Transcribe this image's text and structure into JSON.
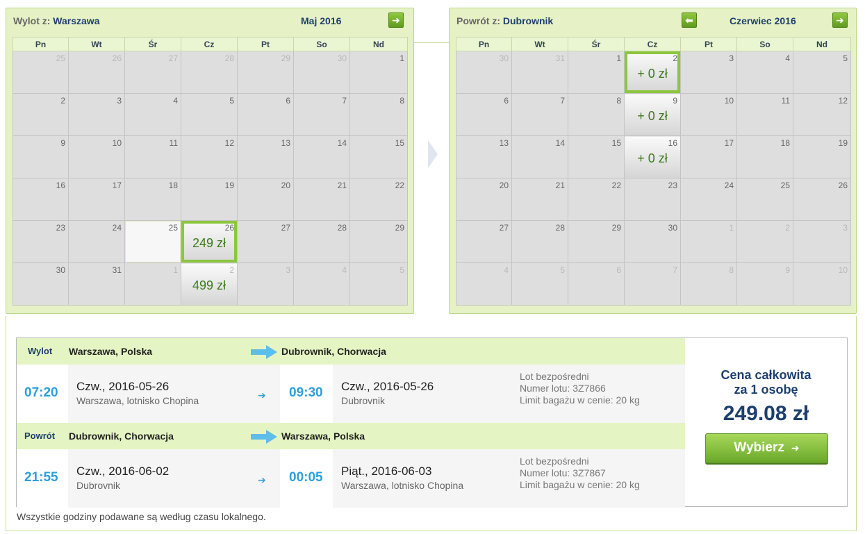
{
  "outbound_calendar": {
    "title_label": "Wylot z:",
    "title_city": "Warszawa",
    "month": "Maj 2016",
    "next_icon": "arrow-right-icon",
    "weekdays": [
      "Pn",
      "Wt",
      "Śr",
      "Cz",
      "Pt",
      "So",
      "Nd"
    ],
    "weeks": [
      [
        {
          "d": "25",
          "o": true
        },
        {
          "d": "26",
          "o": true
        },
        {
          "d": "27",
          "o": true
        },
        {
          "d": "28",
          "o": true
        },
        {
          "d": "29",
          "o": true
        },
        {
          "d": "30",
          "o": true
        },
        {
          "d": "1"
        }
      ],
      [
        {
          "d": "2"
        },
        {
          "d": "3"
        },
        {
          "d": "4"
        },
        {
          "d": "5"
        },
        {
          "d": "6"
        },
        {
          "d": "7"
        },
        {
          "d": "8"
        }
      ],
      [
        {
          "d": "9"
        },
        {
          "d": "10"
        },
        {
          "d": "11"
        },
        {
          "d": "12"
        },
        {
          "d": "13"
        },
        {
          "d": "14"
        },
        {
          "d": "15"
        }
      ],
      [
        {
          "d": "16"
        },
        {
          "d": "17"
        },
        {
          "d": "18"
        },
        {
          "d": "19"
        },
        {
          "d": "20"
        },
        {
          "d": "21"
        },
        {
          "d": "22"
        }
      ],
      [
        {
          "d": "23"
        },
        {
          "d": "24"
        },
        {
          "d": "25",
          "hover": true
        },
        {
          "d": "26",
          "price": "249 zł",
          "selected": true
        },
        {
          "d": "27"
        },
        {
          "d": "28"
        },
        {
          "d": "29"
        }
      ],
      [
        {
          "d": "30"
        },
        {
          "d": "31"
        },
        {
          "d": "1",
          "o": true
        },
        {
          "d": "2",
          "o": true,
          "price": "499 zł"
        },
        {
          "d": "3",
          "o": true
        },
        {
          "d": "4",
          "o": true
        },
        {
          "d": "5",
          "o": true
        }
      ]
    ]
  },
  "return_calendar": {
    "title_label": "Powrót z:",
    "title_city": "Dubrownik",
    "month": "Czerwiec 2016",
    "prev_icon": "arrow-left-icon",
    "next_icon": "arrow-right-icon",
    "weekdays": [
      "Pn",
      "Wt",
      "Śr",
      "Cz",
      "Pt",
      "So",
      "Nd"
    ],
    "weeks": [
      [
        {
          "d": "30",
          "o": true
        },
        {
          "d": "31",
          "o": true
        },
        {
          "d": "1"
        },
        {
          "d": "2",
          "price": "+ 0 zł",
          "selected": true
        },
        {
          "d": "3"
        },
        {
          "d": "4"
        },
        {
          "d": "5"
        }
      ],
      [
        {
          "d": "6"
        },
        {
          "d": "7"
        },
        {
          "d": "8"
        },
        {
          "d": "9",
          "price": "+ 0 zł"
        },
        {
          "d": "10"
        },
        {
          "d": "11"
        },
        {
          "d": "12"
        }
      ],
      [
        {
          "d": "13"
        },
        {
          "d": "14"
        },
        {
          "d": "15"
        },
        {
          "d": "16",
          "price": "+ 0 zł"
        },
        {
          "d": "17"
        },
        {
          "d": "18"
        },
        {
          "d": "19"
        }
      ],
      [
        {
          "d": "20"
        },
        {
          "d": "21"
        },
        {
          "d": "22"
        },
        {
          "d": "23"
        },
        {
          "d": "24"
        },
        {
          "d": "25"
        },
        {
          "d": "26"
        }
      ],
      [
        {
          "d": "27"
        },
        {
          "d": "28"
        },
        {
          "d": "29"
        },
        {
          "d": "30"
        },
        {
          "d": "1",
          "o": true
        },
        {
          "d": "2",
          "o": true
        },
        {
          "d": "3",
          "o": true
        }
      ],
      [
        {
          "d": "4",
          "o": true
        },
        {
          "d": "5",
          "o": true
        },
        {
          "d": "6",
          "o": true
        },
        {
          "d": "7",
          "o": true
        },
        {
          "d": "8",
          "o": true
        },
        {
          "d": "9",
          "o": true
        },
        {
          "d": "10",
          "o": true
        }
      ]
    ]
  },
  "outbound": {
    "label": "Wylot",
    "from": "Warszawa, Polska",
    "to": "Dubrownik, Chorwacja",
    "dep_time": "07:20",
    "dep_date": "Czw., 2016-05-26",
    "dep_place": "Warszawa, lotnisko Chopina",
    "arr_time": "09:30",
    "arr_date": "Czw., 2016-05-26",
    "arr_place": "Dubrovnik",
    "direct": "Lot bezpośredni",
    "flight_no": "Numer lotu: 3Z7866",
    "baggage": "Limit bagażu w cenie: 20 kg"
  },
  "return": {
    "label": "Powrót",
    "from": "Dubrownik, Chorwacja",
    "to": "Warszawa, Polska",
    "dep_time": "21:55",
    "dep_date": "Czw., 2016-06-02",
    "dep_place": "Dubrovnik",
    "arr_time": "00:05",
    "arr_date": "Piąt., 2016-06-03",
    "arr_place": "Warszawa, lotnisko Chopina",
    "direct": "Lot bezpośredni",
    "flight_no": "Numer lotu: 3Z7867",
    "baggage": "Limit bagażu w cenie: 20 kg"
  },
  "price_box": {
    "title_line1": "Cena całkowita",
    "title_line2": "za 1 osobę",
    "total": "249.08 zł",
    "button_label": "Wybierz",
    "button_icon": "arrow-right-icon"
  },
  "footer_note": "Wszystkie godziny podawane są według czasu lokalnego.",
  "colors": {
    "accent_green": "#8cc63f",
    "price_green": "#3d7a1a",
    "time_blue": "#2e9fd9",
    "navy": "#1d3f6e",
    "panel_bg": "#e6f2c6"
  }
}
